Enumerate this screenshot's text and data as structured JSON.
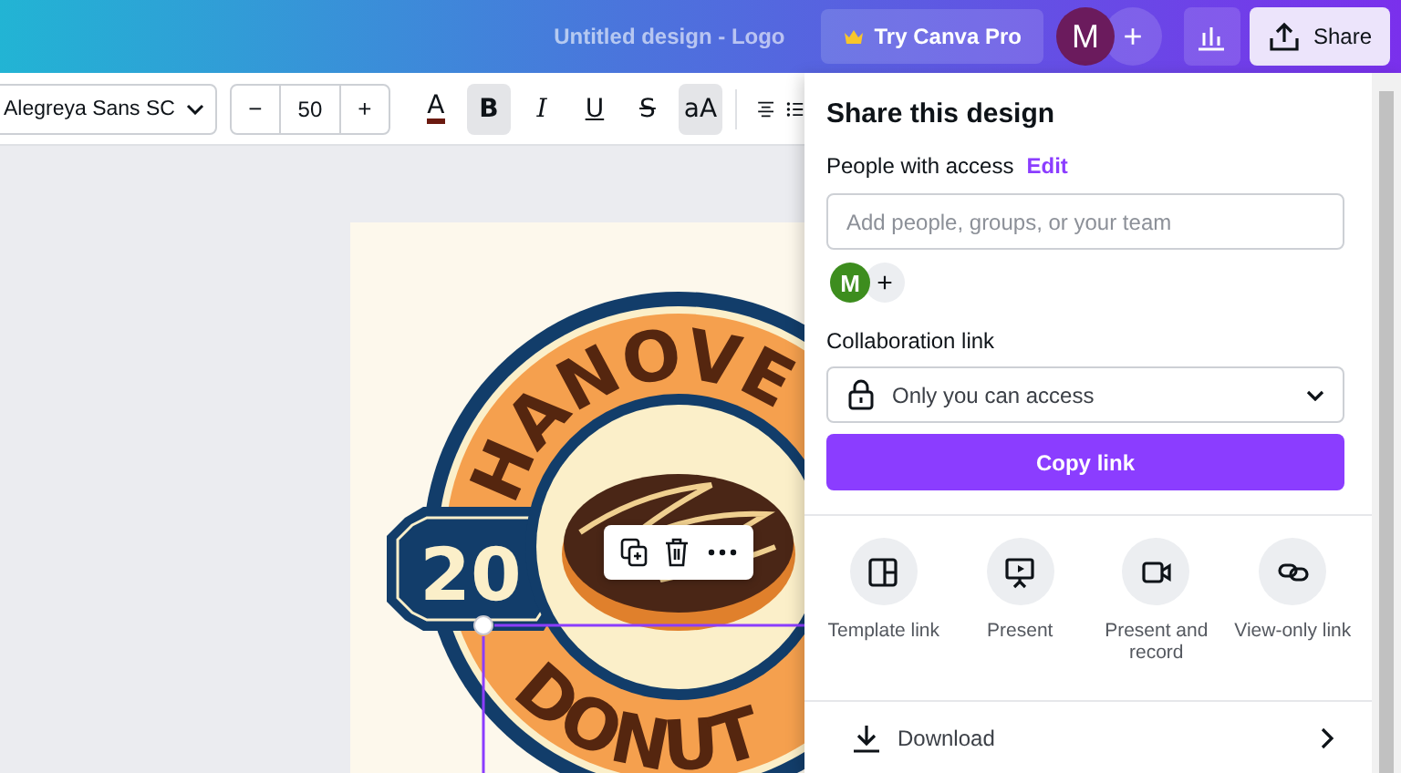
{
  "top_bar": {
    "document_title": "Untitled design - Logo",
    "pro_button": "Try Canva Pro",
    "avatar": "M",
    "add_member": "+",
    "share_button": "Share"
  },
  "toolbar": {
    "font": "Alegreya Sans SC",
    "size_decrease": "−",
    "font_size": "50",
    "size_increase": "+",
    "format_buttons": [
      {
        "label": "A",
        "kind": "color",
        "selected": false
      },
      {
        "label": "B",
        "kind": "bold",
        "selected": true
      },
      {
        "label": "I",
        "kind": "italic",
        "selected": false
      },
      {
        "label": "U",
        "kind": "underline",
        "selected": false
      },
      {
        "label": "S",
        "kind": "strike",
        "selected": false
      },
      {
        "label": "aA",
        "kind": "case",
        "selected": true
      }
    ]
  },
  "canvas": {
    "logo_top_text": "HANOVE",
    "logo_badge_text": "20",
    "logo_bottom_text": "DONUT"
  },
  "share_panel": {
    "title": "Share this design",
    "people_label": "People with access",
    "edit_link": "Edit",
    "invite_placeholder": "Add people, groups, or your team",
    "member_avatar": "M",
    "add_person": "+",
    "collab_label": "Collaboration link",
    "access_select": "Only you can access",
    "copy_button": "Copy link",
    "options": [
      {
        "label": "Template link",
        "kind": "template"
      },
      {
        "label": "Present",
        "kind": "present"
      },
      {
        "label": "Present and record",
        "kind": "record"
      },
      {
        "label": "View-only link",
        "kind": "view"
      }
    ],
    "download": "Download"
  }
}
